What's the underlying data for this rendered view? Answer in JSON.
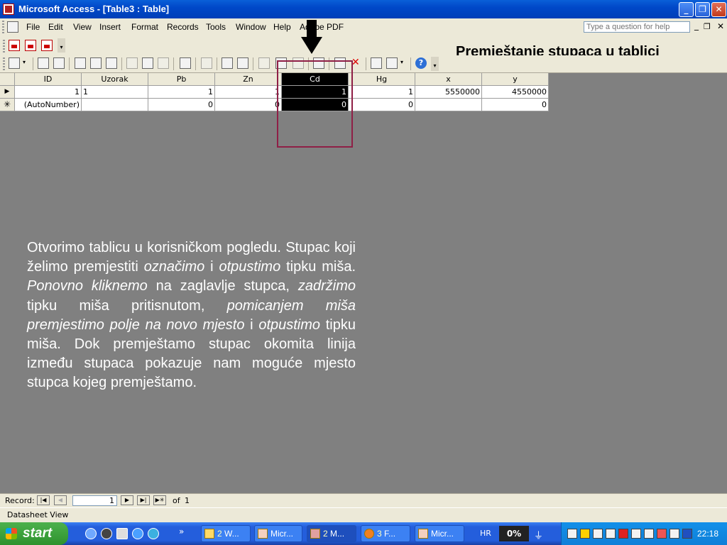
{
  "window": {
    "title": "Microsoft Access - [Table3 : Table]"
  },
  "menu": [
    "File",
    "Edit",
    "View",
    "Insert",
    "Format",
    "Records",
    "Tools",
    "Window",
    "Help",
    "Adobe PDF"
  ],
  "help_placeholder": "Type a question for help",
  "slide_heading": "Premještanje stupaca u tablici",
  "table": {
    "columns": [
      "ID",
      "Uzorak",
      "Pb",
      "Zn",
      "Cd",
      "Hg",
      "x",
      "y"
    ],
    "selected_column": "Cd",
    "rows": [
      {
        "selector": "current-record",
        "cells": [
          "1",
          "1",
          "1",
          "1",
          "1",
          "1",
          "5550000",
          "4550000"
        ]
      },
      {
        "selector": "new-record",
        "cells": [
          "(AutoNumber)",
          "",
          "0",
          "0",
          "0",
          "0",
          "",
          "0"
        ]
      }
    ]
  },
  "instruction": {
    "p1": "Otvorimo tablicu u korisničkom pogledu. Stupac koji želimo premjestiti ",
    "i1": "označimo",
    "p2": " i ",
    "i2": "otpustimo",
    "p3": " tipku miša. ",
    "i3": "Ponovno kliknemo",
    "p4": " na zaglavlje stupca, ",
    "i4": "zadržimo",
    "p5": " tipku miša pritisnutom, ",
    "i5": "pomicanjem miša premjestimo polje na novo mjesto",
    "p6": " i ",
    "i6": "otpustimo",
    "p7": " tipku miša. Dok premještamo stupac okomita linija između stupaca pokazuje nam moguće mjesto stupca kojeg premještamo."
  },
  "record_nav": {
    "label": "Record:",
    "current": "1",
    "of_label": "of",
    "total": "1"
  },
  "status_text": "Datasheet View",
  "taskbar": {
    "start": "start",
    "tasks": [
      {
        "count": "2",
        "label": "W..."
      },
      {
        "count": "",
        "label": "Micr..."
      },
      {
        "count": "2",
        "label": "M..."
      },
      {
        "count": "3",
        "label": "F..."
      },
      {
        "count": "",
        "label": "Micr..."
      }
    ],
    "language": "HR",
    "cpu": "0%",
    "clock": "22:18"
  }
}
